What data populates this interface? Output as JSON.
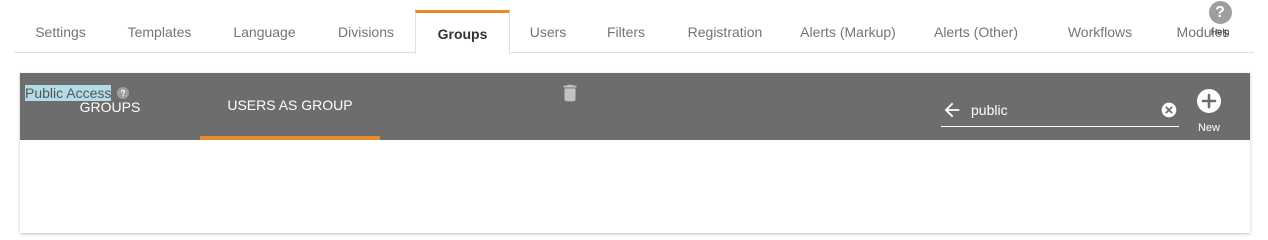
{
  "top_tabs": [
    {
      "label": "Settings",
      "active": false
    },
    {
      "label": "Templates",
      "active": false
    },
    {
      "label": "Language",
      "active": false
    },
    {
      "label": "Divisions",
      "active": false
    },
    {
      "label": "Groups",
      "active": true
    },
    {
      "label": "Users",
      "active": false
    },
    {
      "label": "Filters",
      "active": false
    },
    {
      "label": "Registration",
      "active": false
    },
    {
      "label": "Alerts (Markup)",
      "active": false
    },
    {
      "label": "Alerts (Other)",
      "active": false
    },
    {
      "label": "Workflows",
      "active": false
    },
    {
      "label": "Modules",
      "active": false
    }
  ],
  "help": {
    "icon": "question-icon",
    "symbol": "?",
    "label": "Help"
  },
  "sub_tabs": [
    {
      "label": "GROUPS",
      "active": false
    },
    {
      "label": "USERS AS GROUP",
      "active": true
    }
  ],
  "search": {
    "value": "public",
    "back_icon": "arrow-left-icon",
    "clear_icon": "clear-icon"
  },
  "new_button": {
    "label": "New",
    "icon": "plus-circle-icon"
  },
  "rows": [
    {
      "name": "Public Access",
      "help_icon": "question-icon",
      "edit_icon": "pencil-icon",
      "delete_icon": "trash-icon"
    }
  ],
  "colors": {
    "accent": "#e8892b",
    "header_bg": "#6d6d6d",
    "selection": "#b3dbe8"
  }
}
